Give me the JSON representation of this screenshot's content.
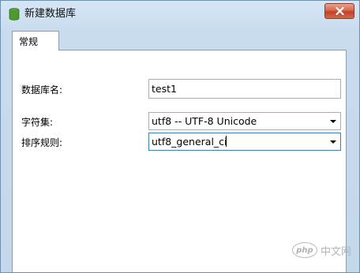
{
  "window": {
    "title": "新建数据库",
    "icon": "database-icon",
    "close_icon": "close-icon"
  },
  "tabs": [
    {
      "label": "常规",
      "selected": true
    }
  ],
  "form": {
    "db_name": {
      "label": "数据库名:",
      "value": "test1"
    },
    "charset": {
      "label": "字符集:",
      "value": "utf8 -- UTF-8 Unicode"
    },
    "collation": {
      "label": "排序规则:",
      "value": "utf8_general_ci"
    }
  },
  "watermark": {
    "logo_text": "php",
    "text": "中文网"
  },
  "colors": {
    "titlebar": "#cfe0f1",
    "close_button": "#c1412a",
    "focus_border": "#3c7fb1"
  }
}
